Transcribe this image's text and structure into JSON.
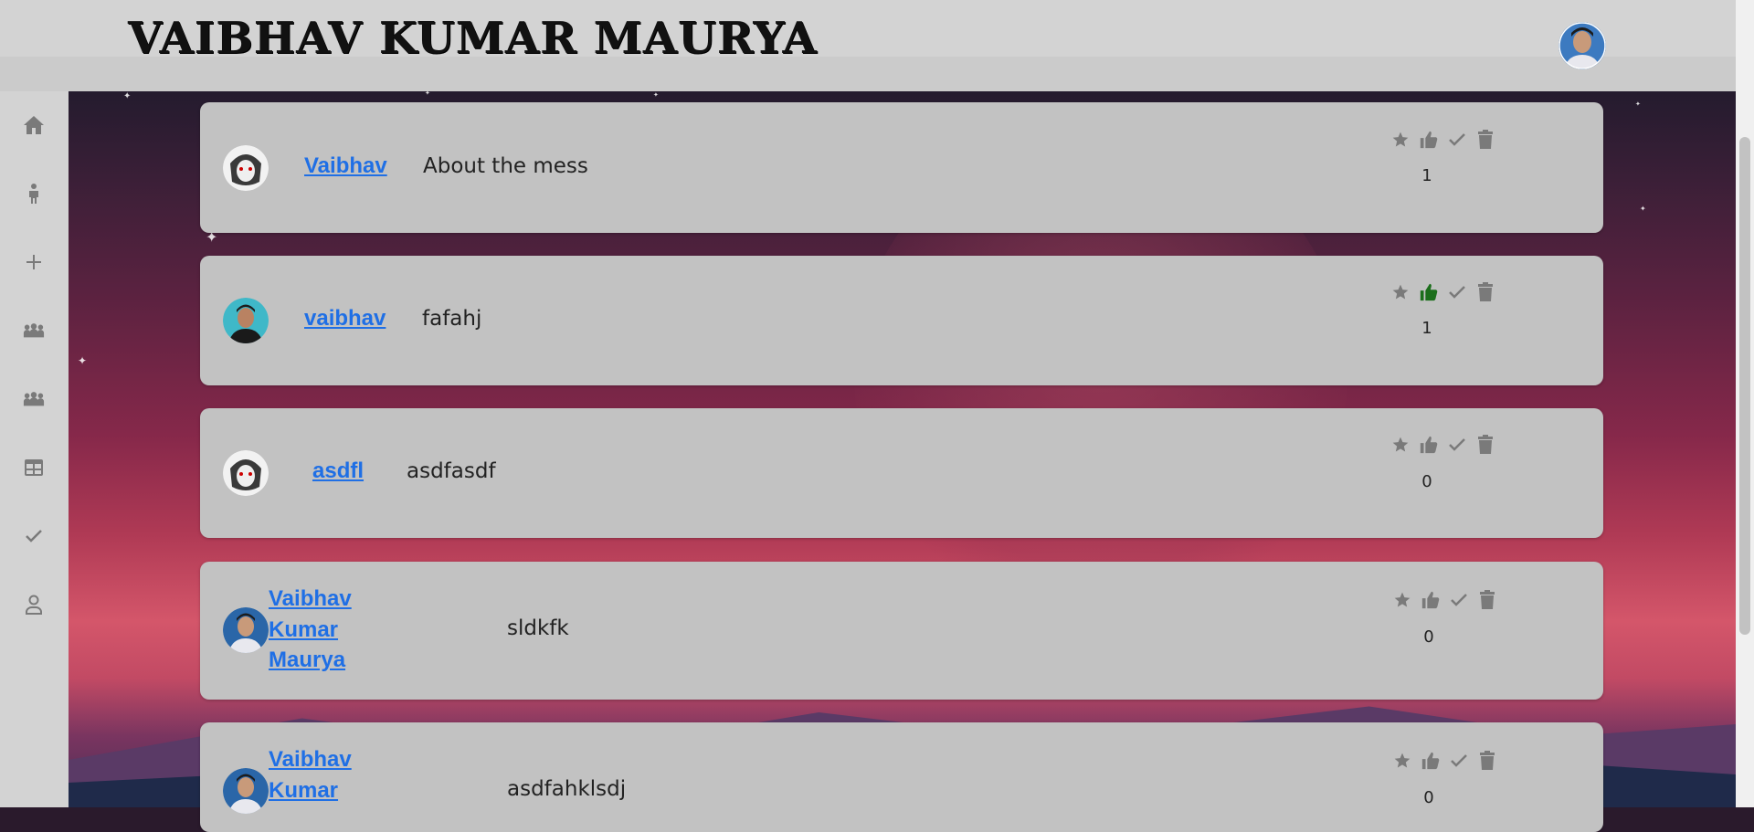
{
  "header": {
    "title": "VAIBHAV KUMAR MAURYA"
  },
  "sidebar": {
    "items": [
      {
        "icon": "home-icon"
      },
      {
        "icon": "person-icon"
      },
      {
        "icon": "plus-icon"
      },
      {
        "icon": "group-icon"
      },
      {
        "icon": "group-icon"
      },
      {
        "icon": "table-icon"
      },
      {
        "icon": "check-icon"
      },
      {
        "icon": "profile-icon"
      }
    ]
  },
  "colors": {
    "link": "#1f6fe5",
    "liked": "#1b6e1b",
    "icon": "#7a7a7a",
    "card": "#c2c2c2"
  },
  "posts": [
    {
      "user": "Vaibhav",
      "message": "About the mess",
      "count": "1",
      "liked": false
    },
    {
      "user": "vaibhav",
      "message": "fafahj",
      "count": "1",
      "liked": true
    },
    {
      "user": "asdfl",
      "message": "asdfasdf",
      "count": "0",
      "liked": false
    },
    {
      "user_lines": [
        "Vaibhav",
        "Kumar",
        "Maurya"
      ],
      "message": "sldkfk",
      "count": "0",
      "liked": false
    },
    {
      "user_lines": [
        "Vaibhav",
        "Kumar"
      ],
      "message": "asdfahklsdj",
      "count": "0",
      "liked": false
    }
  ]
}
